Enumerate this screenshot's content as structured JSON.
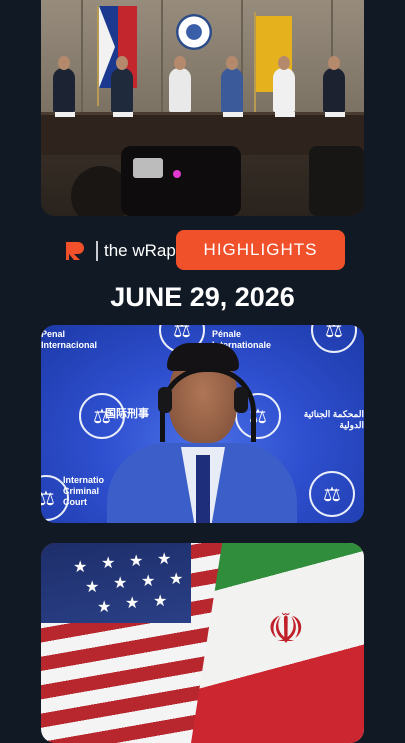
{
  "brand": {
    "logo_text": "r",
    "name": "the wRap"
  },
  "highlights_label": "HIGHLIGHTS",
  "date": "JUNE 29, 2026",
  "icc": {
    "left_top": "Penal\nInternacional",
    "center_top": "Pénale\nInternationale",
    "chinese": "国际刑事",
    "arabic": "المحكمة الجنائية الدولية",
    "left_bottom": "Internatio\nCriminal\nCourt"
  },
  "icons": [
    "scales-emblem-icon",
    "rappler-logo-icon",
    "iran-emblem-icon"
  ],
  "colors": {
    "accent": "#f0512b",
    "background": "#111a24"
  }
}
